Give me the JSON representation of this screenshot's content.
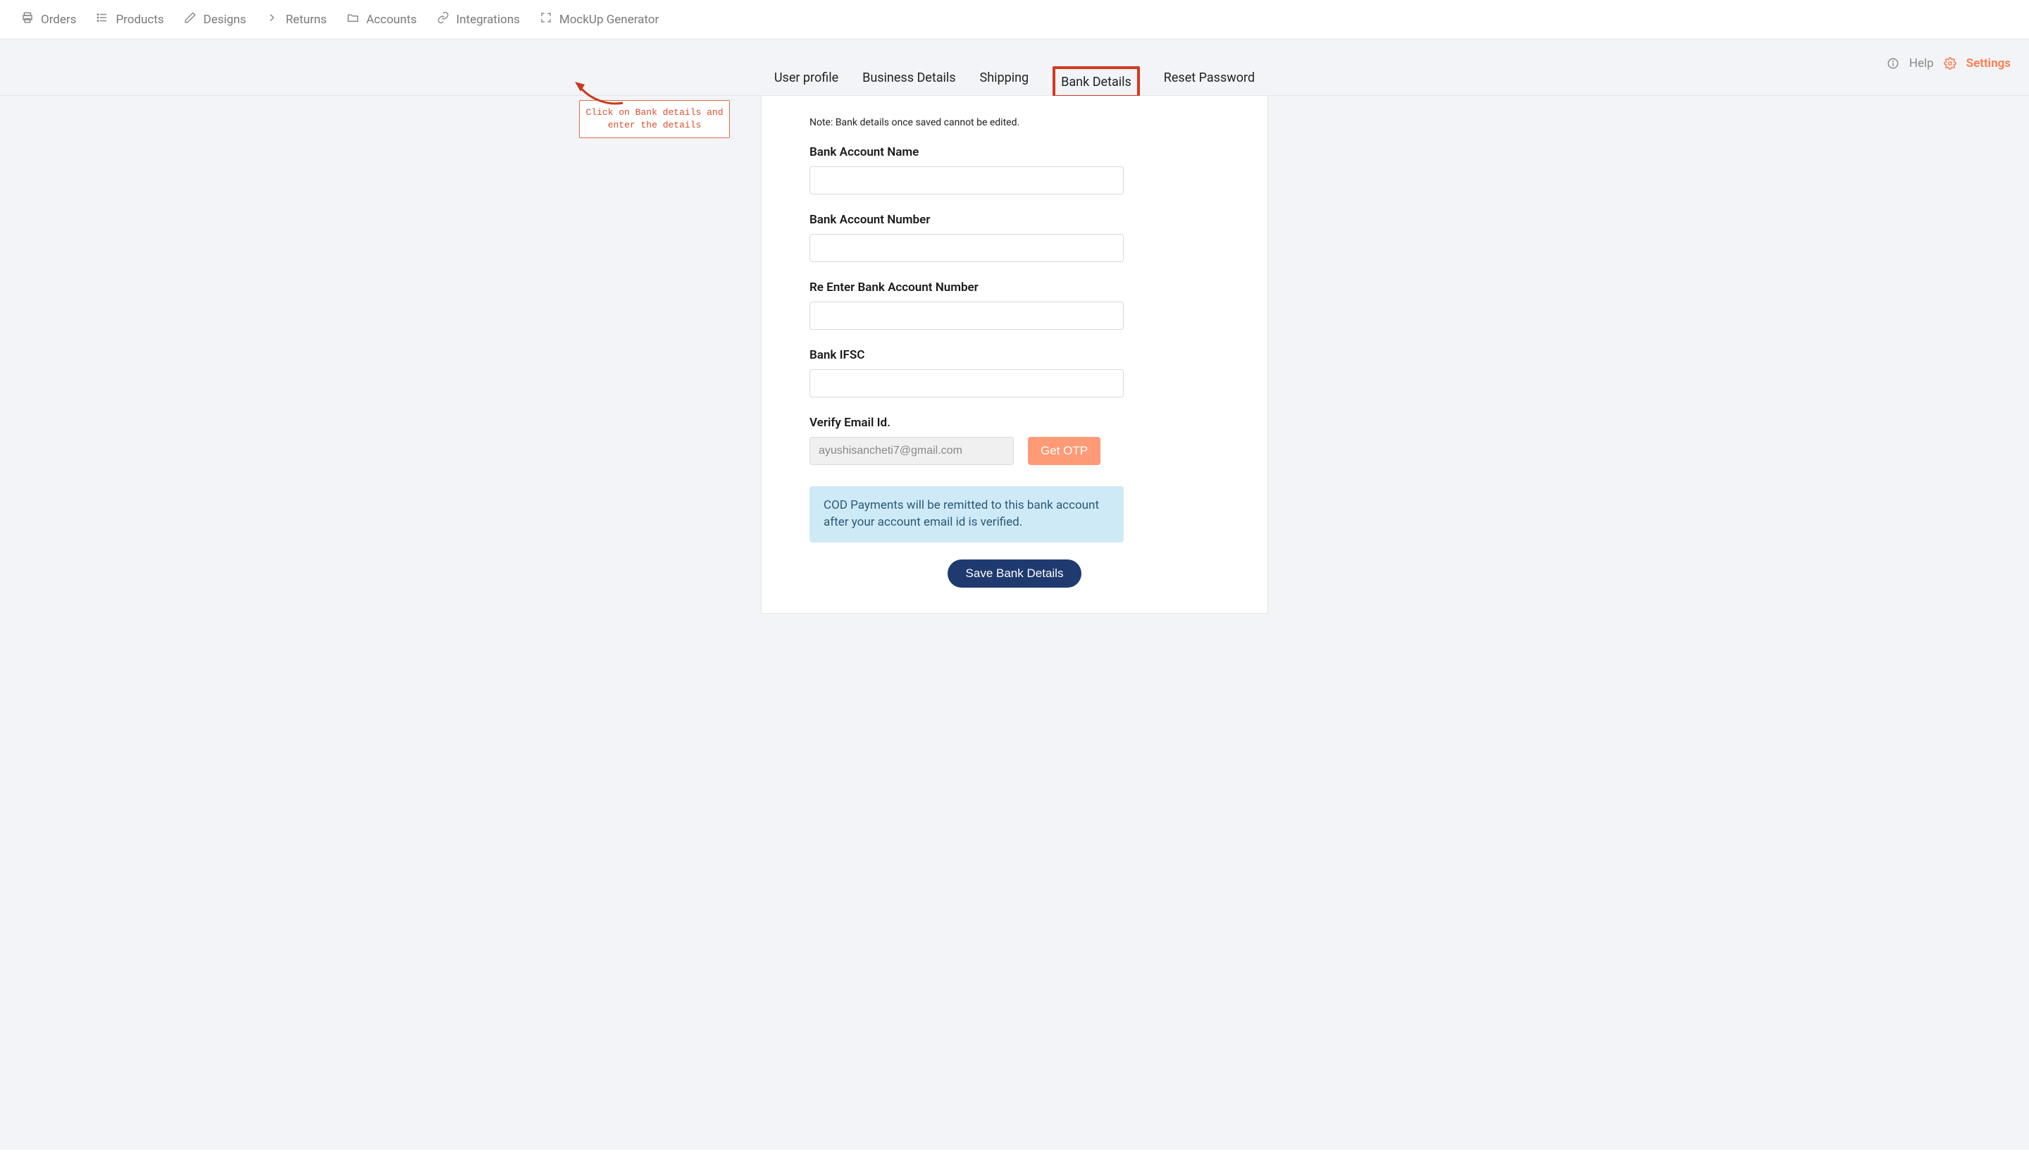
{
  "topnav": {
    "orders": "Orders",
    "products": "Products",
    "designs": "Designs",
    "returns": "Returns",
    "accounts": "Accounts",
    "integrations": "Integrations",
    "mockup": "MockUp Generator"
  },
  "tools": {
    "help": "Help",
    "settings": "Settings"
  },
  "tabs": {
    "user_profile": "User profile",
    "business_details": "Business Details",
    "shipping": "Shipping",
    "bank_details": "Bank Details",
    "reset_password": "Reset Password"
  },
  "form": {
    "note": "Note: Bank details once saved cannot be edited.",
    "bank_account_name_label": "Bank Account Name",
    "bank_account_name_value": "",
    "bank_account_number_label": "Bank Account Number",
    "bank_account_number_value": "",
    "re_bank_account_number_label": "Re Enter Bank Account Number",
    "re_bank_account_number_value": "",
    "bank_ifsc_label": "Bank IFSC",
    "bank_ifsc_value": "",
    "verify_email_label": "Verify Email Id.",
    "verify_email_value": "ayushisancheti7@gmail.com",
    "get_otp": "Get OTP",
    "info": "COD Payments will be remitted to this bank account after your account email id is verified.",
    "save": "Save Bank Details"
  },
  "annotation": {
    "text": "Click on Bank details and enter the details"
  }
}
